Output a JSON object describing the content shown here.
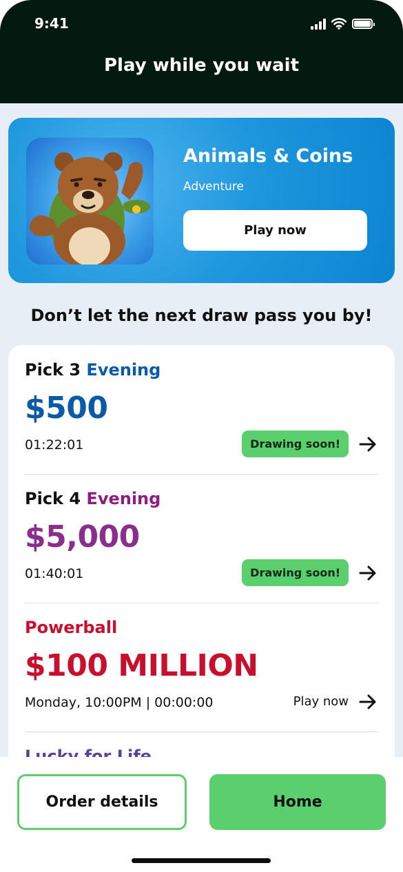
{
  "status_bar": {
    "time": "9:41"
  },
  "header": {
    "title": "Play while you wait"
  },
  "promo": {
    "title": "Animals & Coins",
    "genre": "Adventure",
    "button_label": "Play now"
  },
  "section": {
    "heading": "Don’t let the next draw pass you by!"
  },
  "draws": [
    {
      "name": "Pick 3",
      "variant": "Evening",
      "variant_color": "#0a5aa8",
      "amount": "$500",
      "amount_color": "#0a5aa8",
      "time": "01:22:01",
      "badge": "Drawing soon!"
    },
    {
      "name": "Pick 4",
      "variant": "Evening",
      "variant_color": "#8a1f7f",
      "amount": "$5,000",
      "amount_color": "#8a2d8c",
      "time": "01:40:01",
      "badge": "Drawing soon!"
    },
    {
      "name": "Powerball",
      "name_color": "#c8102e",
      "amount": "$100 MILLION",
      "amount_color": "#c8102e",
      "time": "Monday, 10:00PM | 00:00:00",
      "link": "Play now"
    },
    {
      "name": "Lucky for Life",
      "name_color": "#5a3fa0"
    }
  ],
  "bottom_bar": {
    "order_details_label": "Order details",
    "home_label": "Home"
  },
  "colors": {
    "header_bg": "#04190f",
    "accent_green": "#5bce6e",
    "promo_blue": "#1f97dd",
    "page_bg": "#e7eef6"
  }
}
